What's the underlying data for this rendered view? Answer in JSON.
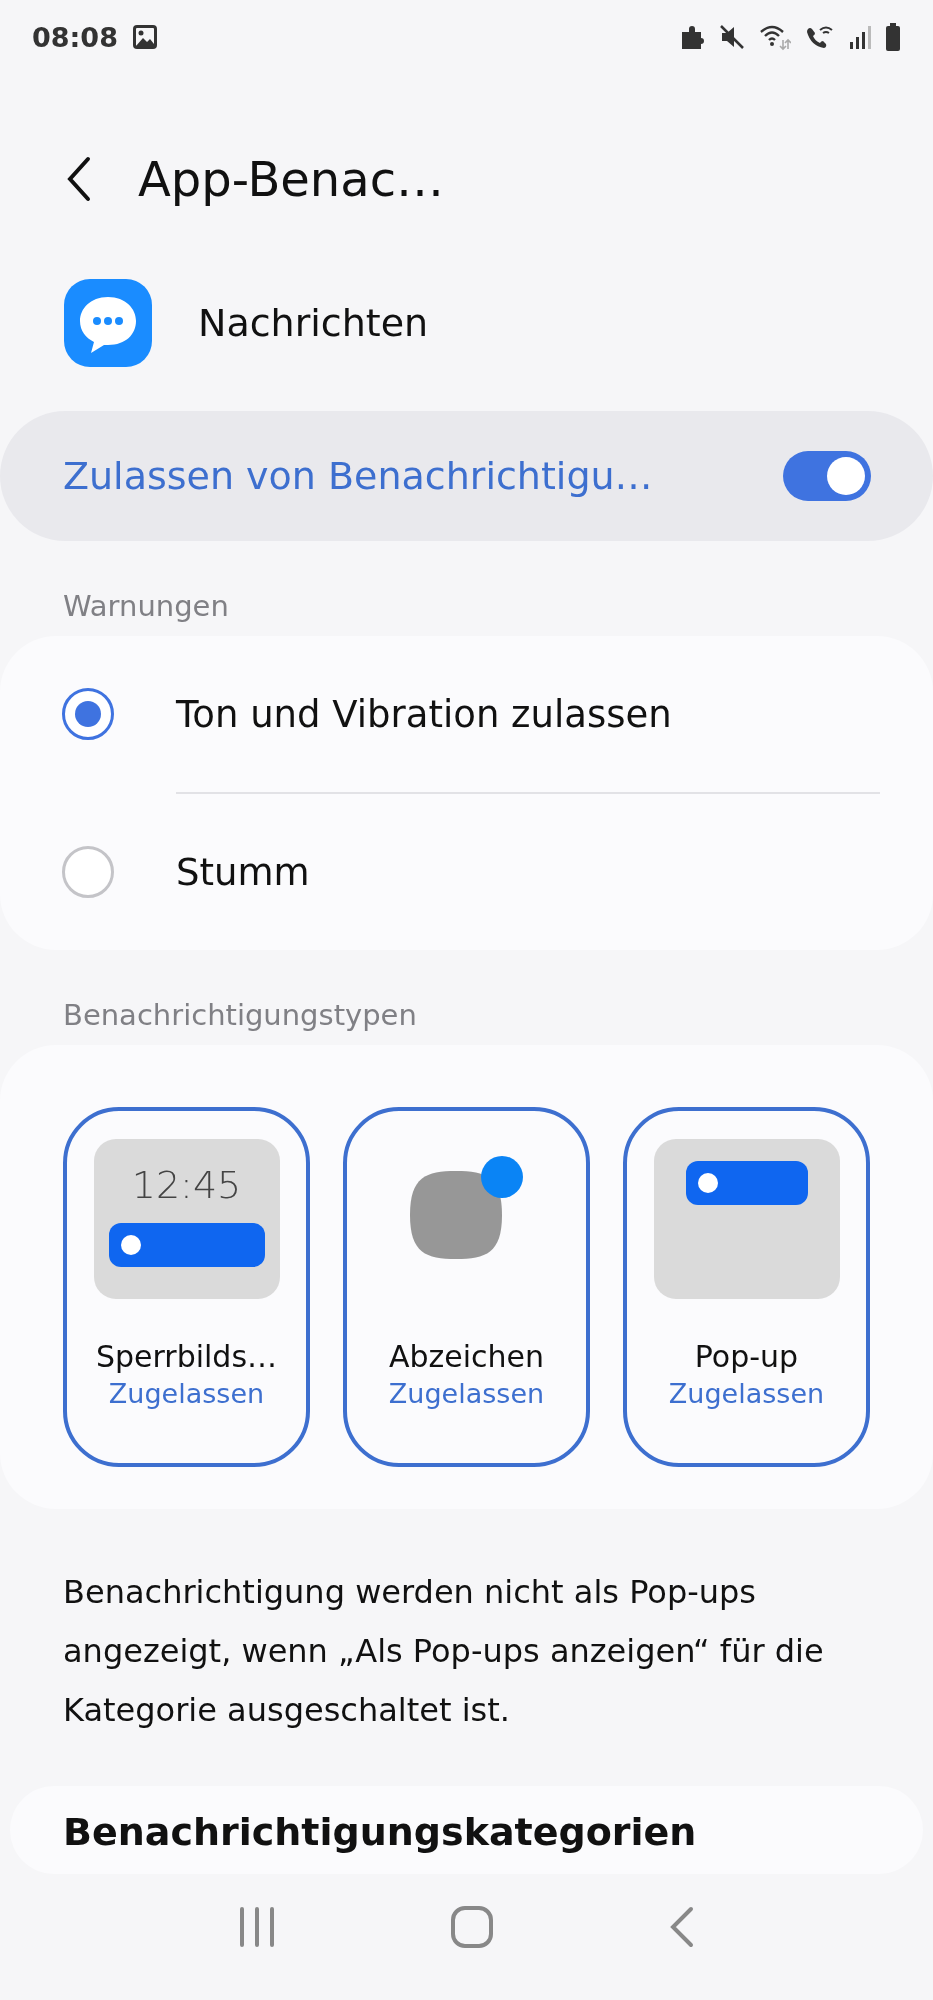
{
  "status_bar": {
    "time": "08:08"
  },
  "header": {
    "title": "App-Benac…"
  },
  "app": {
    "name": "Nachrichten"
  },
  "allow_notifications": {
    "label": "Zulassen von Benachrichtigu…",
    "on": true
  },
  "alerts": {
    "heading": "Warnungen",
    "options": [
      {
        "label": "Ton und Vibration zulassen",
        "selected": true
      },
      {
        "label": "Stumm",
        "selected": false
      }
    ]
  },
  "notification_types": {
    "heading": "Benachrichtigungstypen",
    "items": [
      {
        "kind": "lockscreen",
        "label": "Sperrbilds…",
        "status": "Zugelassen",
        "selected": true,
        "time": "12:45"
      },
      {
        "kind": "badge",
        "label": "Abzeichen",
        "status": "Zugelassen",
        "selected": true
      },
      {
        "kind": "popup",
        "label": "Pop-up",
        "status": "Zugelassen",
        "selected": true
      }
    ]
  },
  "note": "Benachrichtigung werden nicht als Pop-ups angezeigt, wenn „Als Pop-ups anzeigen“ für die Kategorie ausgeschaltet ist.",
  "categories": {
    "title": "Benachrichtigungskategorien"
  }
}
